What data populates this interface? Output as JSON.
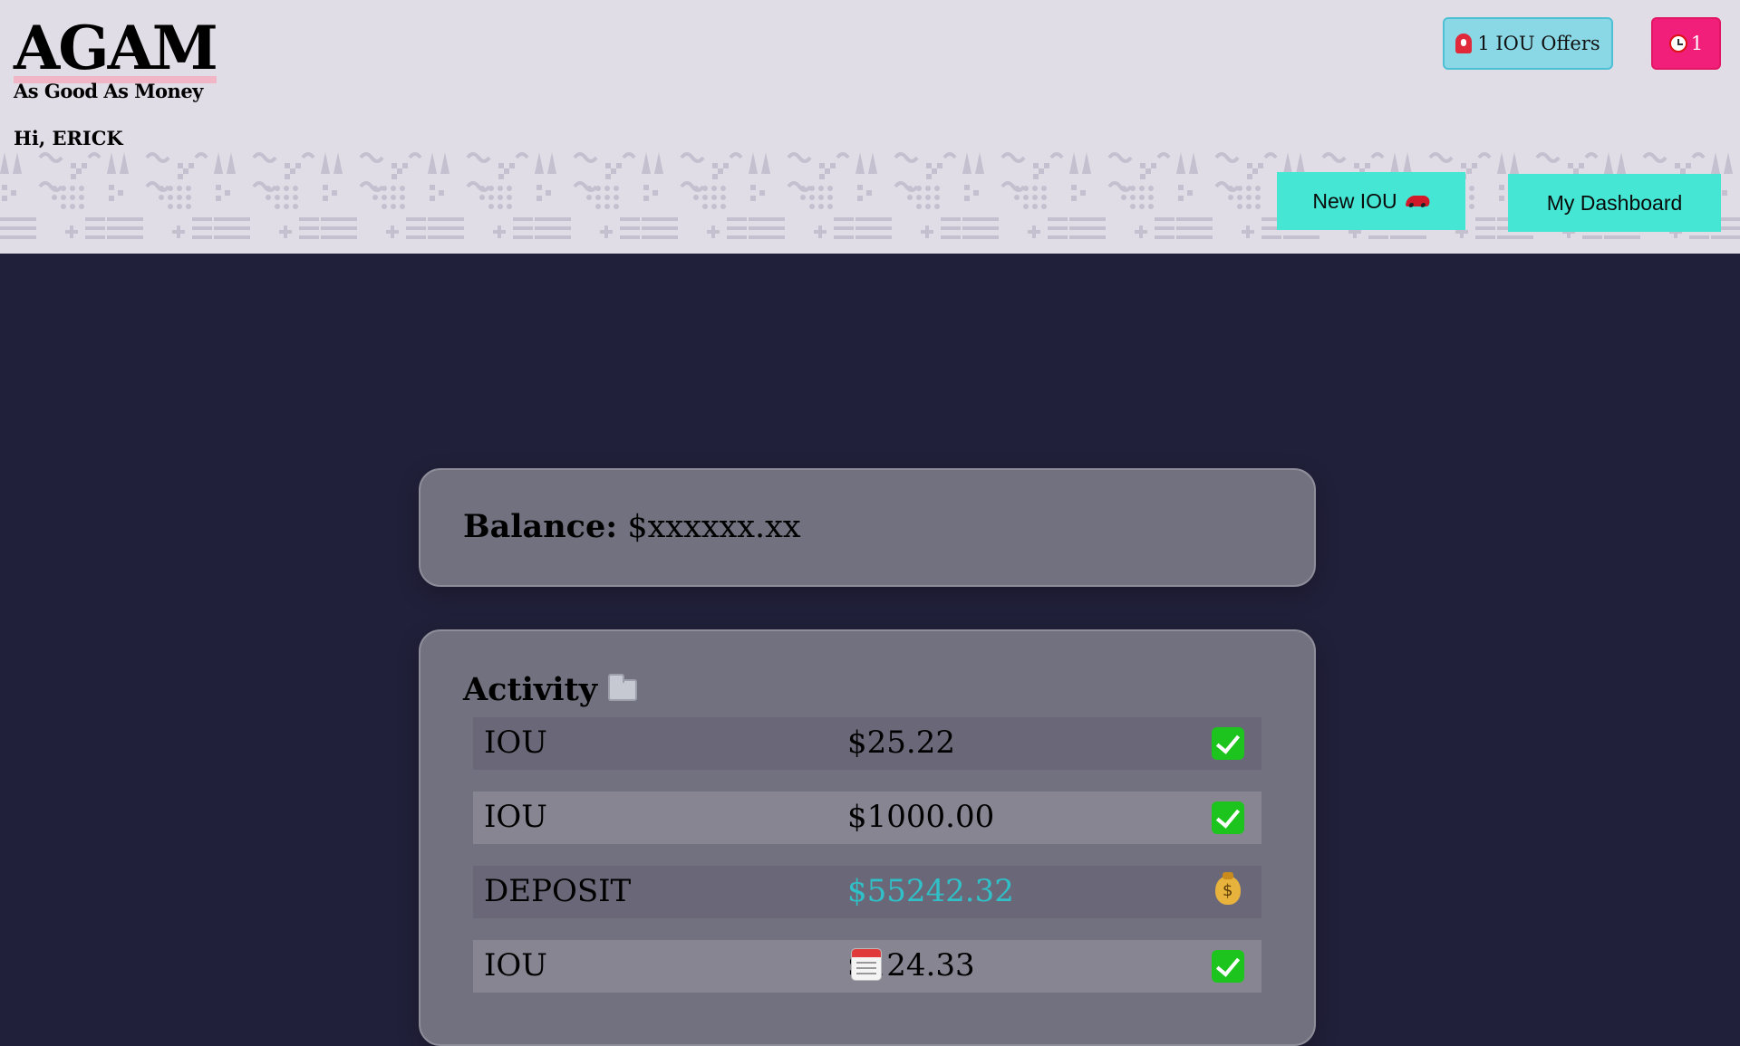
{
  "app": {
    "logo_title": "AGAM",
    "logo_subtitle": "As Good As Money",
    "greeting": "Hi, ERICK"
  },
  "header": {
    "offers_label": "1 IOU Offers",
    "offers_icon": "siren-icon",
    "alerts_count": "1",
    "alerts_icon": "alarm-clock-icon",
    "new_iou_label": "New IOU",
    "new_iou_icon": "race-car-icon",
    "dashboard_label": "My Dashboard"
  },
  "balance": {
    "label": "Balance:",
    "value": "$xxxxxx.xx"
  },
  "activity": {
    "title": "Activity",
    "title_icon": "open-folder-icon",
    "rows": [
      {
        "type": "IOU",
        "amount": "$25.22",
        "status_icon": "check-mark-icon"
      },
      {
        "type": "IOU",
        "amount": "$1000.00",
        "status_icon": "check-mark-icon"
      },
      {
        "type": "DEPOSIT",
        "amount": "$55242.32",
        "status_icon": "money-bag-icon"
      },
      {
        "type": "IOU",
        "amount": "$124.33",
        "status_icon": "check-mark-icon",
        "extra_icon": "calendar-icon"
      }
    ]
  },
  "colors": {
    "page_bg": "#21203a",
    "header_bg": "#e0dde6",
    "accent_teal": "#45e7d4",
    "offers_bg": "#8ad8e6",
    "alert_pink": "#f21f7a",
    "card_bg": "#72717f",
    "deposit_text": "#2fc0c8"
  }
}
